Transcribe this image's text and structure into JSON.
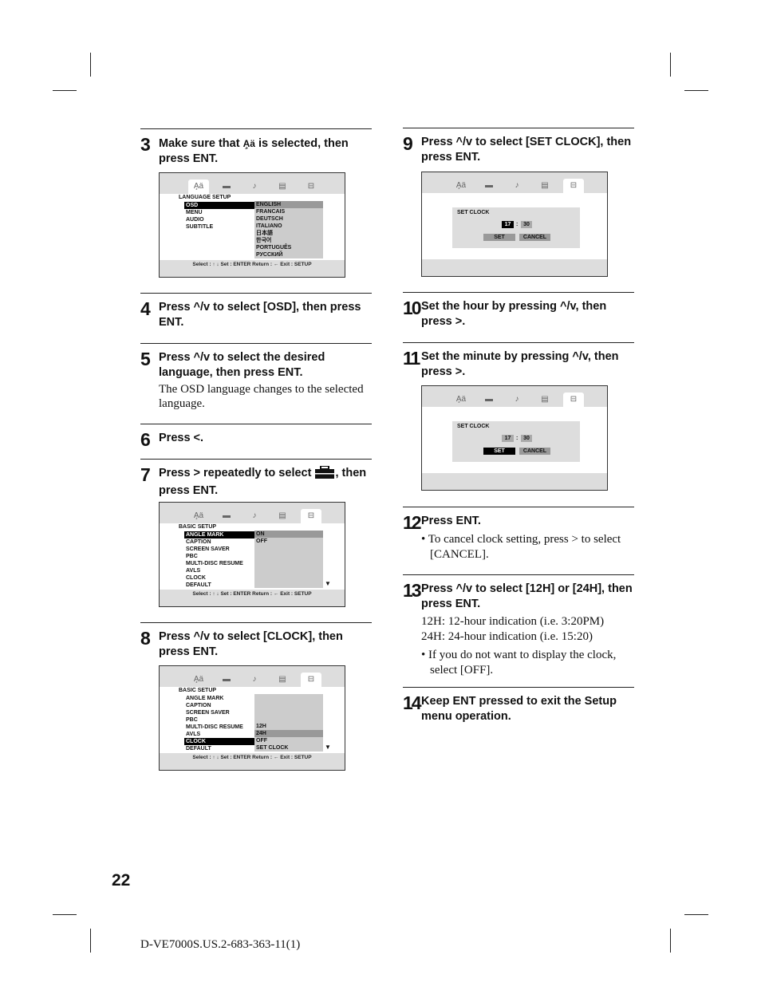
{
  "page": {
    "number": "22",
    "doc_id": "D-VE7000S.US.2-683-363-11(1)"
  },
  "steps": [
    {
      "num": "3",
      "head_a": "Make sure that ",
      "head_b": " is selected, then press ENT."
    },
    {
      "num": "4",
      "head": "Press ^/v to select [OSD], then press ENT."
    },
    {
      "num": "5",
      "head": "Press ^/v to select the desired language, then press ENT.",
      "body": "The OSD language changes to the selected language."
    },
    {
      "num": "6",
      "head": "Press <."
    },
    {
      "num": "7",
      "head_a": "Press > repeatedly to select ",
      "head_b": ", then press ENT."
    },
    {
      "num": "8",
      "head": "Press ^/v to select [CLOCK], then press ENT."
    },
    {
      "num": "9",
      "head": "Press ^/v to select [SET CLOCK], then press ENT."
    },
    {
      "num": "10",
      "head": "Set the hour by pressing ^/v, then press >."
    },
    {
      "num": "11",
      "head": "Set the minute by pressing ^/v, then press >."
    },
    {
      "num": "12",
      "head": "Press ENT.",
      "bullet": "• To cancel clock setting, press > to select [CANCEL]."
    },
    {
      "num": "13",
      "head": "Press ^/v to select [12H] or [24H], then press ENT.",
      "body1": "12H: 12-hour indication (i.e. 3:20PM)",
      "body2": "24H: 24-hour indication (i.e. 15:20)",
      "bullet": "• If you do not want to display the clock, select [OFF]."
    },
    {
      "num": "14",
      "head": "Keep ENT pressed to exit the Setup menu operation."
    }
  ],
  "osd": {
    "tabs": [
      "language-setup-icon",
      "screen-setup-icon",
      "audio-setup-icon",
      "parental-control-icon",
      "basic-setup-icon"
    ],
    "footer": "Select : ↑ ↓   Set : ENTER  Return : ←   Exit : SETUP",
    "language_screen": {
      "title": "LANGUAGE SETUP",
      "items": [
        "OSD",
        "MENU",
        "AUDIO",
        "SUBTITLE"
      ],
      "selected_item": "OSD",
      "options": [
        "ENGLISH",
        "FRANCAIS",
        "DEUTSCH",
        "ITALIANO",
        "日本語",
        "한국어",
        "PORTUGUÊS",
        "РУССКИЙ"
      ],
      "highlighted_option": "ENGLISH"
    },
    "basic_screen_1": {
      "title": "BASIC SETUP",
      "items": [
        "ANGLE MARK",
        "CAPTION",
        "SCREEN SAVER",
        "PBC",
        "MULTI-DISC RESUME",
        "AVLS",
        "CLOCK",
        "DEFAULT"
      ],
      "selected_item": "ANGLE MARK",
      "options": [
        "ON",
        "OFF"
      ],
      "highlighted_option": "ON"
    },
    "basic_screen_2": {
      "title": "BASIC SETUP",
      "items": [
        "ANGLE MARK",
        "CAPTION",
        "SCREEN SAVER",
        "PBC",
        "MULTI-DISC RESUME",
        "AVLS",
        "CLOCK",
        "DEFAULT"
      ],
      "selected_item": "CLOCK",
      "options": [
        "12H",
        "24H",
        "OFF",
        "SET CLOCK"
      ],
      "highlighted_option": "24H"
    },
    "clock_screen_1": {
      "title": "SET CLOCK",
      "hour": "17",
      "minute": "30",
      "set_label": "SET",
      "cancel_label": "CANCEL",
      "focus": "hour"
    },
    "clock_screen_2": {
      "title": "SET CLOCK",
      "hour": "17",
      "minute": "30",
      "set_label": "SET",
      "cancel_label": "CANCEL",
      "focus": "set"
    }
  }
}
